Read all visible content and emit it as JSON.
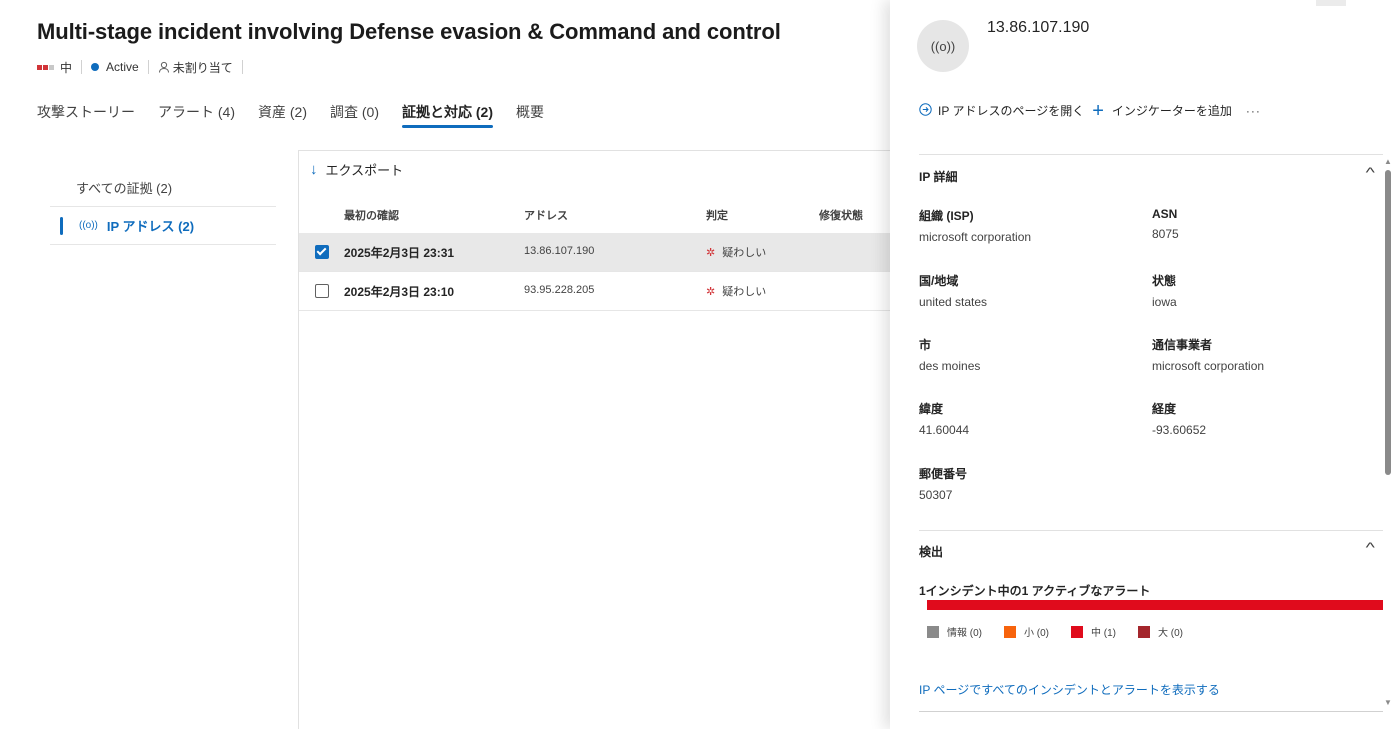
{
  "incident": {
    "title": "Multi-stage incident involving Defense evasion & Command and control",
    "severity": "中",
    "status": "Active",
    "assignee": "未割り当て"
  },
  "tabs": [
    {
      "label": "攻撃ストーリー"
    },
    {
      "label": "アラート (4)"
    },
    {
      "label": "資産 (2)"
    },
    {
      "label": "調査 (0)"
    },
    {
      "label": "証拠と対応 (2)",
      "active": true
    },
    {
      "label": "概要"
    }
  ],
  "evidence_nav": {
    "all": "すべての証拠 (2)",
    "ip": "IP アドレス (2)"
  },
  "toolbar": {
    "export": "エクスポート"
  },
  "table": {
    "columns": [
      "最初の確認",
      "アドレス",
      "判定",
      "修復状態"
    ],
    "rows": [
      {
        "first_seen": "2025年2月3日 23:31",
        "address": "13.86.107.190",
        "verdict": "疑わしい",
        "selected": true
      },
      {
        "first_seen": "2025年2月3日 23:10",
        "address": "93.95.228.205",
        "verdict": "疑わしい",
        "selected": false
      }
    ]
  },
  "panel": {
    "ip": "13.86.107.190",
    "open_page": "IP アドレスのページを開く",
    "add_indicator": "インジケーターを追加",
    "more": "···",
    "ip_details_title": "IP 詳細",
    "fields": {
      "isp_label": "組織 (ISP)",
      "isp": "microsoft corporation",
      "asn_label": "ASN",
      "asn": "8075",
      "country_label": "国/地域",
      "country": "united states",
      "state_label": "状態",
      "state": "iowa",
      "city_label": "市",
      "city": "des moines",
      "carrier_label": "通信事業者",
      "carrier": "microsoft corporation",
      "lat_label": "緯度",
      "lat": "41.60044",
      "lon_label": "経度",
      "lon": "-93.60652",
      "zip_label": "郵便番号",
      "zip": "50307"
    },
    "detection_title": "検出",
    "detection_summary": "1インシデント中の1 アクティブなアラート",
    "legend": [
      {
        "label": "情報 (0)",
        "color": "#8a8a8a"
      },
      {
        "label": "小 (0)",
        "color": "#f7630c"
      },
      {
        "label": "中 (1)",
        "color": "#e00b1c"
      },
      {
        "label": "大 (0)",
        "color": "#a4262c"
      }
    ],
    "view_all_link": "IP ページですべてのインシデントとアラートを表示する"
  },
  "colors": {
    "accent": "#0f6cbd",
    "severity_red": "#e00b1c"
  }
}
